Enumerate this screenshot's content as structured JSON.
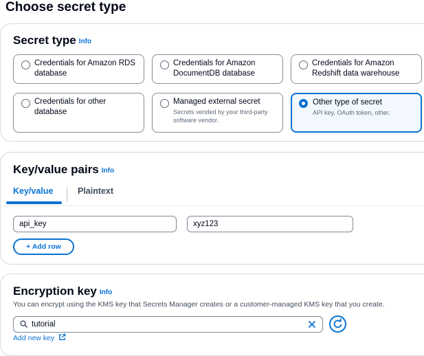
{
  "page_title": "Choose secret type",
  "secret_type": {
    "title": "Secret type",
    "info": "Info",
    "options": [
      {
        "label": "Credentials for Amazon RDS database",
        "desc": "",
        "selected": false
      },
      {
        "label": "Credentials for Amazon DocumentDB database",
        "desc": "",
        "selected": false
      },
      {
        "label": "Credentials for Amazon Redshift data warehouse",
        "desc": "",
        "selected": false
      },
      {
        "label": "Credentials for other database",
        "desc": "",
        "selected": false
      },
      {
        "label": "Managed external secret",
        "desc": "Secrets vended by your third-party software vendor.",
        "selected": false
      },
      {
        "label": "Other type of secret",
        "desc": "API key, OAuth token, other.",
        "selected": true
      }
    ]
  },
  "key_value": {
    "title": "Key/value pairs",
    "info": "Info",
    "tabs": [
      {
        "label": "Key/value",
        "active": true
      },
      {
        "label": "Plaintext",
        "active": false
      }
    ],
    "rows": [
      {
        "key": "api_key",
        "value": "xyz123"
      }
    ],
    "add_row_label": "+ Add row"
  },
  "encryption": {
    "title": "Encryption key",
    "info": "Info",
    "description": "You can encrypt using the KMS key that Secrets Manager creates or a customer-managed KMS key that you create.",
    "search_value": "tutorial",
    "add_new_key_label": "Add new key"
  },
  "colors": {
    "accent": "#0972d3",
    "selected_bg": "#f2f8fd",
    "border": "#8c8c94"
  }
}
